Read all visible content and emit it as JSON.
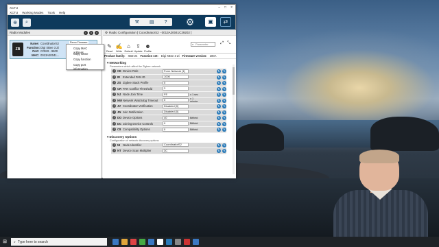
{
  "window": {
    "title": "XCTU",
    "menu": [
      "XCTU",
      "Working Modes",
      "Tools",
      "Help"
    ],
    "controls": [
      "–",
      "□",
      "×"
    ]
  },
  "left_pane": {
    "title": "Radio Modules",
    "module": {
      "icon_text": "ZB",
      "name_label": "Name:",
      "name_value": "CoordinatorS2",
      "function_label": "Function:",
      "function_value": "Digi XBee 3 Zi",
      "port_label": "Port:",
      "port_value": "COM3 - 9600",
      "mac_label": "MAC:",
      "mac_value": "0013A20041...",
      "badge": "Remo Firmware"
    },
    "context_menu": [
      "Copy MAC address",
      "Copy name",
      "Copy function",
      "Copy port information"
    ]
  },
  "right_pane": {
    "title": "Radio Configuration [ CoordinatorS2 - 0013A20041C29202 ]",
    "actions": [
      {
        "label": "Read",
        "icon": "pencil-down-icon",
        "glyph": "✎"
      },
      {
        "label": "Write",
        "icon": "pencil-up-icon",
        "glyph": "✍"
      },
      {
        "label": "Default",
        "icon": "factory-icon",
        "glyph": "⌂"
      },
      {
        "label": "Update",
        "icon": "update-icon",
        "glyph": "⇪"
      },
      {
        "label": "Profile",
        "icon": "profile-icon",
        "glyph": "☻"
      }
    ],
    "search_placeholder": "Parameter",
    "info": {
      "family_label": "Product family:",
      "family_value": "XB3-24",
      "function_label": "Function set:",
      "function_value": "Digi XBee 3 Zi",
      "firmware_label": "Firmware version:",
      "firmware_value": "100A"
    },
    "sections": [
      {
        "title": "Networking",
        "subtitle": "Parameters which affect the Zigbee network",
        "rows": [
          {
            "code": "CE",
            "label": "Device Role",
            "value": "Form Network [1]",
            "unit": ""
          },
          {
            "code": "ID",
            "label": "Extended PAN ID",
            "value": "1000",
            "unit": ""
          },
          {
            "code": "ZS",
            "label": "Zigbee Stack Profile",
            "value": "0",
            "unit": ""
          },
          {
            "code": "CR",
            "label": "PAN Conflict Threshold",
            "value": "3",
            "unit": ""
          },
          {
            "code": "NJ",
            "label": "Node Join Time",
            "value": "FE",
            "unit": "x 1 sec"
          },
          {
            "code": "NW",
            "label": "Network Watchdog Timeout",
            "value": "0",
            "unit": "x 1 minute"
          },
          {
            "code": "JV",
            "label": "Coordinator Verification",
            "value": "Disabled [0]",
            "unit": ""
          },
          {
            "code": "JN",
            "label": "Join Notification",
            "value": "Disabled [0]",
            "unit": ""
          },
          {
            "code": "DO",
            "label": "Device Options",
            "value": "40",
            "unit": "Bitfield"
          },
          {
            "code": "DC",
            "label": "Joining Device Controls",
            "value": "0",
            "unit": "Bitfield"
          },
          {
            "code": "C8",
            "label": "Compatibility Options",
            "value": "0",
            "unit": "Bitfield"
          }
        ]
      },
      {
        "title": "Discovery Options",
        "subtitle": "Configuration of network discovery options",
        "rows": [
          {
            "code": "NI",
            "label": "Node Identifier",
            "value": "CoordinatorS2",
            "unit": ""
          },
          {
            "code": "NT",
            "label": "Device Scan Multiplier",
            "value": "3C",
            "unit": ""
          }
        ]
      }
    ]
  },
  "taskbar": {
    "search_placeholder": "Type here to search",
    "apps": [
      "#3a78c2",
      "#e0a53b",
      "#d44",
      "#4a4",
      "#3a78c2",
      "#fff",
      "#2a7ab8",
      "#888",
      "#c33",
      "#3a78c2"
    ]
  }
}
